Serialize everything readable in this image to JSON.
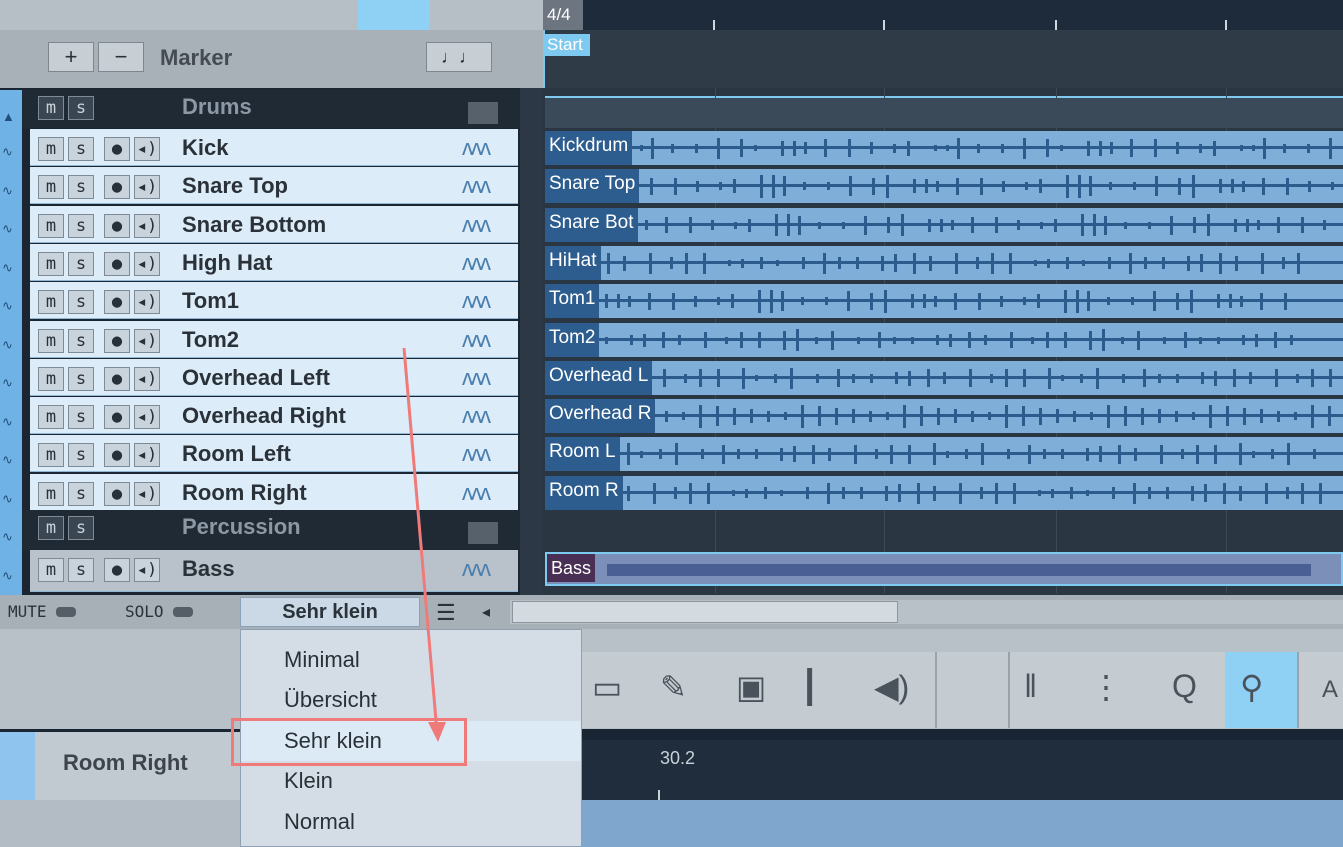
{
  "timeline": {
    "time_signature": "4/4"
  },
  "marker": {
    "label": "Marker",
    "add": "+",
    "remove": "−",
    "notes_icon": "♩♩",
    "start_tag": "Start"
  },
  "folders": [
    {
      "name": "Drums"
    },
    {
      "name": "Percussion"
    }
  ],
  "button_labels": {
    "mute": "m",
    "solo": "s",
    "record": "●",
    "monitor": "◂)"
  },
  "tracks": [
    {
      "name": "Kick",
      "clip": "Kickdrum"
    },
    {
      "name": "Snare Top",
      "clip": "Snare Top"
    },
    {
      "name": "Snare Bottom",
      "clip": "Snare Bot"
    },
    {
      "name": "High Hat",
      "clip": "HiHat"
    },
    {
      "name": "Tom1",
      "clip": "Tom1"
    },
    {
      "name": "Tom2",
      "clip": "Tom2"
    },
    {
      "name": "Overhead Left",
      "clip": "Overhead L"
    },
    {
      "name": "Overhead Right",
      "clip": "Overhead R"
    },
    {
      "name": "Room Left",
      "clip": "Room L"
    },
    {
      "name": "Room Right",
      "clip": "Room R"
    }
  ],
  "bass": {
    "name": "Bass",
    "clip": "Bass"
  },
  "bottom_bar": {
    "mute": "MUTE",
    "solo": "SOLO",
    "track_size": "Sehr klein"
  },
  "size_menu": {
    "options": [
      "Minimal",
      "Übersicht",
      "Sehr klein",
      "Klein",
      "Normal"
    ],
    "selected": "Sehr klein"
  },
  "editor": {
    "track_label": "Room Right",
    "position": "30.2"
  },
  "colors": {
    "accent": "#7ec9ef",
    "clip": "#7fafd9",
    "highlight_box": "#f07a7a"
  }
}
